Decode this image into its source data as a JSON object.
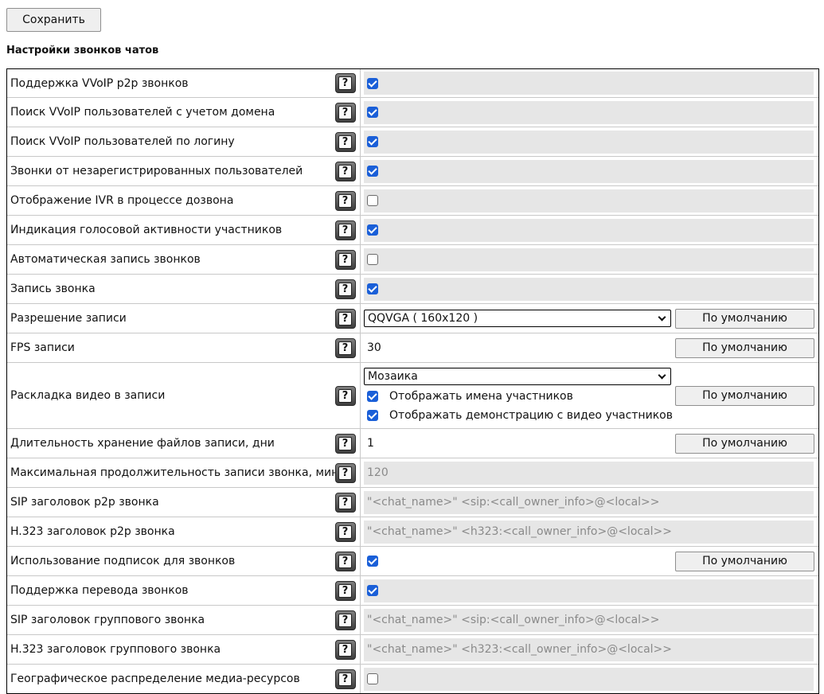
{
  "toolbar": {
    "save_label": "Сохранить"
  },
  "section_title": "Настройки звонков чатов",
  "help_glyph": "?",
  "default_label": "По умолчанию",
  "rows": [
    {
      "label": "Поддержка VVoIP p2p звонков",
      "checked": true
    },
    {
      "label": "Поиск VVoIP пользователей с учетом домена",
      "checked": true
    },
    {
      "label": "Поиск VVoIP пользователей по логину",
      "checked": true
    },
    {
      "label": "Звонки от незарегистрированных пользователей",
      "checked": true
    },
    {
      "label": "Отображение IVR в процессе дозвона",
      "checked": false
    },
    {
      "label": "Индикация голосовой активности участников",
      "checked": true
    },
    {
      "label": "Автоматическая запись звонков",
      "checked": false
    },
    {
      "label": "Запись звонка",
      "checked": true
    },
    {
      "label": "Разрешение записи",
      "selected": "QQVGA ( 160x120 )"
    },
    {
      "label": "FPS записи",
      "value": "30"
    },
    {
      "label": "Раскладка видео в записи",
      "selected": "Мозаика",
      "options": [
        {
          "label": "Отображать имена участников",
          "checked": true
        },
        {
          "label": "Отображать демонстрацию с видео участников",
          "checked": true
        }
      ]
    },
    {
      "label": "Длительность хранение файлов записи, дни",
      "value": "1"
    },
    {
      "label": "Максимальная продолжительность записи звонка, мин",
      "value": "120"
    },
    {
      "label": "SIP заголовок p2p звонка",
      "value": "\"<chat_name>\" <sip:<call_owner_info>@<local>>"
    },
    {
      "label": "H.323 заголовок p2p звонка",
      "value": "\"<chat_name>\" <h323:<call_owner_info>@<local>>"
    },
    {
      "label": "Использование подписок для звонков",
      "checked": true
    },
    {
      "label": "Поддержка перевода звонков",
      "checked": true
    },
    {
      "label": "SIP заголовок группового звонка",
      "value": "\"<chat_name>\" <sip:<call_owner_info>@<local>>"
    },
    {
      "label": "H.323 заголовок группового звонка",
      "value": "\"<chat_name>\" <h323:<call_owner_info>@<local>>"
    },
    {
      "label": "Географическое распределение медиа-ресурсов",
      "checked": false
    }
  ]
}
